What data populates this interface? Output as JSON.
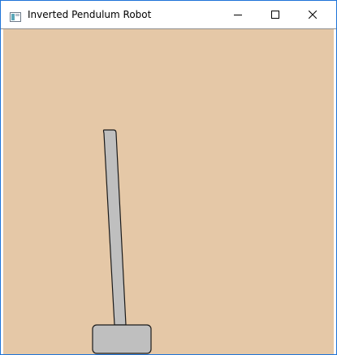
{
  "window": {
    "title": "Inverted Pendulum Robot",
    "controls": {
      "minimize": "minimize-icon",
      "maximize": "maximize-icon",
      "close": "close-icon"
    }
  },
  "scene": {
    "background_color": "#e5c8a7",
    "body_fill": "#bfbfbf",
    "outline_color": "#1a1a1a"
  }
}
